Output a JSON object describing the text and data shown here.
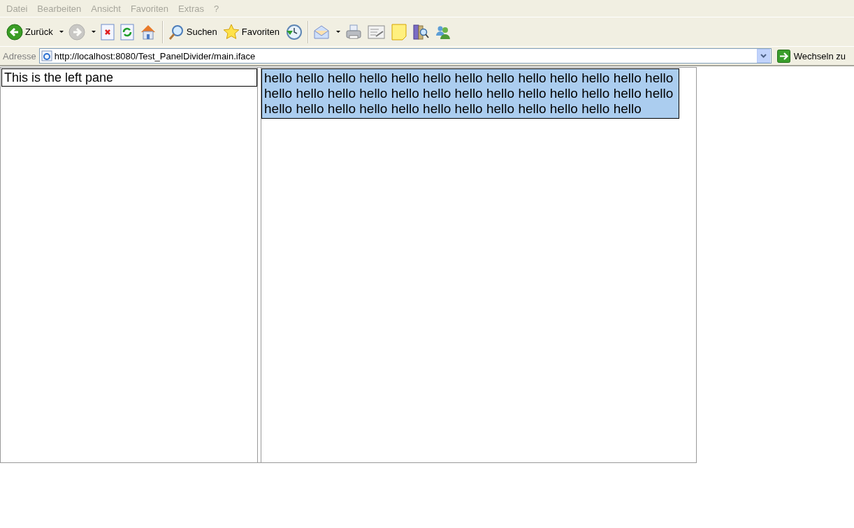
{
  "menu_bar": {
    "items": [
      "Datei",
      "Bearbeiten",
      "Ansicht",
      "Favoriten",
      "Extras",
      "?"
    ]
  },
  "toolbar": {
    "buttons": [
      {
        "kind": "back",
        "label": "Zurück",
        "disabled": false,
        "dropdown": true
      },
      {
        "kind": "forward",
        "disabled": true,
        "dropdown": true
      },
      {
        "kind": "stop",
        "disabled": false,
        "dropdown": false
      },
      {
        "kind": "refresh",
        "disabled": false,
        "dropdown": false
      },
      {
        "kind": "home",
        "disabled": false,
        "dropdown": false
      },
      {
        "kind": "separator"
      },
      {
        "kind": "search",
        "label": "Suchen",
        "disabled": false,
        "dropdown": false
      },
      {
        "kind": "favorites",
        "label": "Favoriten",
        "disabled": false,
        "dropdown": false
      },
      {
        "kind": "history",
        "disabled": false,
        "dropdown": false
      },
      {
        "kind": "separator"
      },
      {
        "kind": "mail",
        "disabled": false,
        "dropdown": true
      },
      {
        "kind": "print",
        "disabled": false,
        "dropdown": false
      },
      {
        "kind": "edit",
        "disabled": false,
        "dropdown": false
      },
      {
        "kind": "note",
        "disabled": false,
        "dropdown": false
      },
      {
        "kind": "research",
        "disabled": false,
        "dropdown": false
      },
      {
        "kind": "messenger",
        "disabled": false,
        "dropdown": false
      }
    ]
  },
  "address_bar": {
    "label": "Adresse",
    "value": "http://localhost:8080/Test_PanelDivider/main.iface",
    "go_button": "Wechseln zu"
  },
  "left_pane": {
    "header": "This is the left pane"
  },
  "right_pane": {
    "text": "hello hello hello hello hello hello hello hello hello hello hello hello hello hello hello hello hello hello hello hello hello hello hello hello hello hello hello hello hello hello hello hello hello hello hello hello hello hello"
  }
}
